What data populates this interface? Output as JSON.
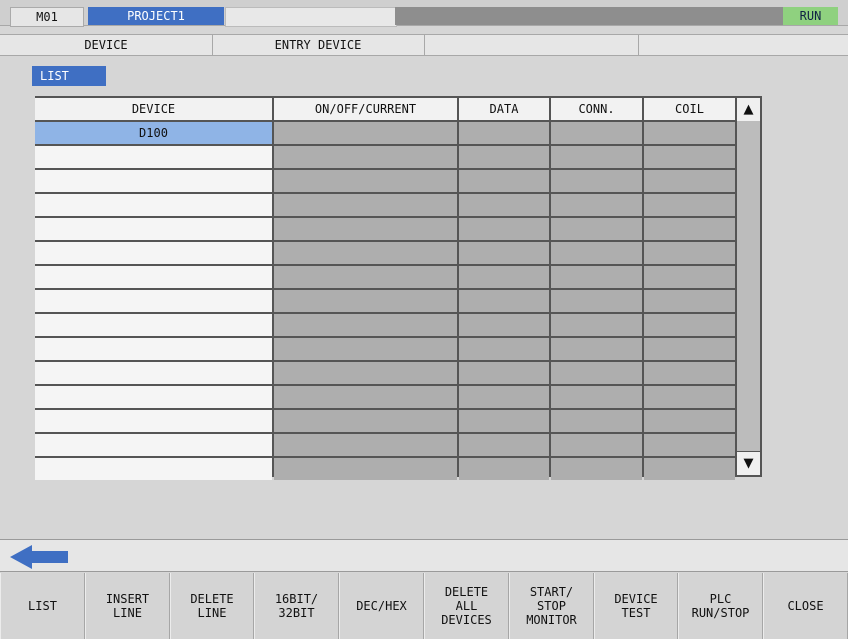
{
  "status_bar": {
    "machine": "M01",
    "project": "PROJECT1",
    "run_status": "RUN"
  },
  "mode_tabs": [
    "DEVICE",
    "ENTRY DEVICE",
    "",
    ""
  ],
  "list_label": "LIST",
  "table": {
    "headers": [
      "DEVICE",
      "ON/OFF/CURRENT",
      "DATA",
      "CONN.",
      "COIL"
    ],
    "rows": [
      [
        "D100",
        "",
        "",
        "",
        ""
      ],
      [
        "",
        "",
        "",
        "",
        ""
      ],
      [
        "",
        "",
        "",
        "",
        ""
      ],
      [
        "",
        "",
        "",
        "",
        ""
      ],
      [
        "",
        "",
        "",
        "",
        ""
      ],
      [
        "",
        "",
        "",
        "",
        ""
      ],
      [
        "",
        "",
        "",
        "",
        ""
      ],
      [
        "",
        "",
        "",
        "",
        ""
      ],
      [
        "",
        "",
        "",
        "",
        ""
      ],
      [
        "",
        "",
        "",
        "",
        ""
      ],
      [
        "",
        "",
        "",
        "",
        ""
      ],
      [
        "",
        "",
        "",
        "",
        ""
      ],
      [
        "",
        "",
        "",
        "",
        ""
      ],
      [
        "",
        "",
        "",
        "",
        ""
      ],
      [
        "",
        "",
        "",
        "",
        ""
      ]
    ],
    "selected_row": 0
  },
  "scroll": {
    "up_icon": "triangle-up-icon",
    "down_icon": "triangle-down-icon",
    "up_glyph": "▲",
    "down_glyph": "▼"
  },
  "back_icon": "back-arrow-icon",
  "function_keys": [
    "LIST",
    "INSERT\nLINE",
    "DELETE\nLINE",
    "16BIT/\n32BIT",
    "DEC/HEX",
    "DELETE\nALL\nDEVICES",
    "START/\nSTOP\nMONITOR",
    "DEVICE\nTEST",
    "PLC\nRUN/STOP",
    "CLOSE"
  ],
  "colors": {
    "accent_blue": "#3f6fc3",
    "selected_cell": "#8fb4e6",
    "run_green": "#8fd17f",
    "back_arrow": "#3f6fc3"
  }
}
